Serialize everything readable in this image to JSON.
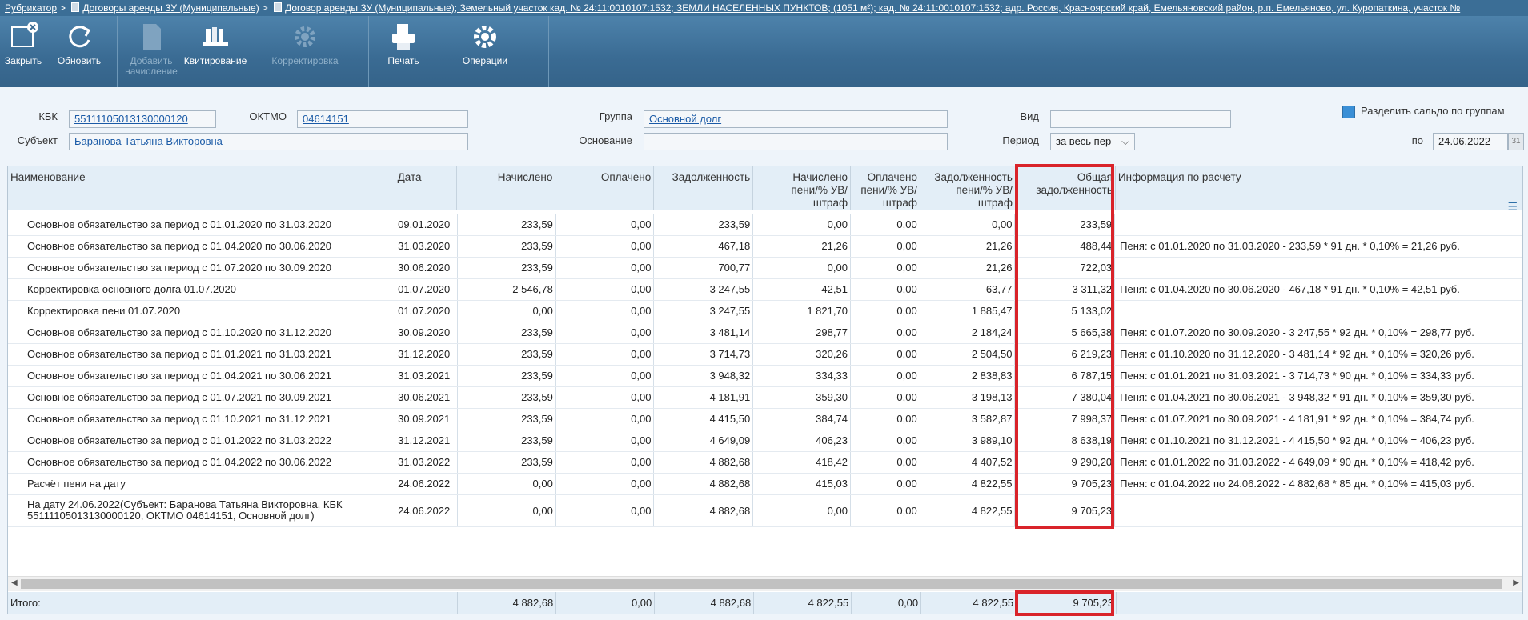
{
  "breadcrumb": {
    "items": [
      "Рубрикатор",
      "Договоры аренды ЗУ (Муниципальные)",
      "Договор аренды ЗУ (Муниципальные); Земельный участок кад. № 24:11:0010107:1532; ЗЕМЛИ НАСЕЛЕННЫХ ПУНКТОВ; (1051 м²); кад. № 24:11:0010107:1532; адр. Россия, Красноярский край, Емельяновский район, р.п. Емельяново, ул. Куропаткина, участок №"
    ],
    "sep": ">"
  },
  "toolbar": {
    "close": "Закрыть",
    "refresh": "Обновить",
    "add_charge": "Добавить начисление",
    "kvit": "Квитирование",
    "correction": "Корректировка",
    "print": "Печать",
    "operations": "Операции"
  },
  "form": {
    "kbk_label": "КБК",
    "kbk_value": "55111105013130000120",
    "oktmo_label": "ОКТМО",
    "oktmo_value": "04614151",
    "subject_label": "Субъект",
    "subject_value": "Баранова Татьяна Викторовна",
    "group_label": "Группа",
    "group_value": "Основной долг",
    "basis_label": "Основание",
    "basis_value": "",
    "vid_label": "Вид",
    "vid_value": "",
    "period_label": "Период",
    "period_value": "за весь пер",
    "split_label": "Разделить сальдо по группам",
    "po_label": "по",
    "date_value": "24.06.2022",
    "calendar_glyph": "31"
  },
  "table": {
    "headers": {
      "name": "Наименование",
      "date": "Дата",
      "charged": "Начислено",
      "paid": "Оплачено",
      "debt": "Задолженность",
      "pen_charged": "Начислено пени/% УВ/ штраф",
      "pen_paid": "Оплачено пени/% УВ/штраф",
      "pen_debt": "Задолженность пени/% УВ/ штраф",
      "total_debt": "Общая задолженность",
      "info": "Информация по расчету"
    },
    "rows": [
      {
        "name": "Основное обязательство за период с 01.01.2020 по 31.03.2020",
        "date": "09.01.2020",
        "charged": "233,59",
        "paid": "0,00",
        "debt": "233,59",
        "pen_charged": "0,00",
        "pen_paid": "0,00",
        "pen_debt": "0,00",
        "total": "233,59",
        "info": ""
      },
      {
        "name": "Основное обязательство за период с 01.04.2020 по 30.06.2020",
        "date": "31.03.2020",
        "charged": "233,59",
        "paid": "0,00",
        "debt": "467,18",
        "pen_charged": "21,26",
        "pen_paid": "0,00",
        "pen_debt": "21,26",
        "total": "488,44",
        "info": "Пеня: с 01.01.2020 по 31.03.2020 - 233,59 *    91 дн. * 0,10%  = 21,26 руб."
      },
      {
        "name": "Основное обязательство за период с 01.07.2020 по 30.09.2020",
        "date": "30.06.2020",
        "charged": "233,59",
        "paid": "0,00",
        "debt": "700,77",
        "pen_charged": "0,00",
        "pen_paid": "0,00",
        "pen_debt": "21,26",
        "total": "722,03",
        "info": ""
      },
      {
        "name": "Корректировка основного долга 01.07.2020",
        "date": "01.07.2020",
        "charged": "2 546,78",
        "paid": "0,00",
        "debt": "3 247,55",
        "pen_charged": "42,51",
        "pen_paid": "0,00",
        "pen_debt": "63,77",
        "total": "3 311,32",
        "info": "Пеня: с 01.04.2020 по 30.06.2020 - 467,18 *    91 дн. * 0,10%  = 42,51 руб."
      },
      {
        "name": "Корректировка пени 01.07.2020",
        "date": "01.07.2020",
        "charged": "0,00",
        "paid": "0,00",
        "debt": "3 247,55",
        "pen_charged": "1 821,70",
        "pen_paid": "0,00",
        "pen_debt": "1 885,47",
        "total": "5 133,02",
        "info": ""
      },
      {
        "name": "Основное обязательство за период с 01.10.2020 по 31.12.2020",
        "date": "30.09.2020",
        "charged": "233,59",
        "paid": "0,00",
        "debt": "3 481,14",
        "pen_charged": "298,77",
        "pen_paid": "0,00",
        "pen_debt": "2 184,24",
        "total": "5 665,38",
        "info": "Пеня: с 01.07.2020 по 30.09.2020 - 3 247,55 *    92 дн. * 0,10%  = 298,77 руб."
      },
      {
        "name": "Основное обязательство за период с 01.01.2021 по 31.03.2021",
        "date": "31.12.2020",
        "charged": "233,59",
        "paid": "0,00",
        "debt": "3 714,73",
        "pen_charged": "320,26",
        "pen_paid": "0,00",
        "pen_debt": "2 504,50",
        "total": "6 219,23",
        "info": "Пеня: с 01.10.2020 по 31.12.2020 - 3 481,14 *    92 дн. * 0,10%  = 320,26 руб."
      },
      {
        "name": "Основное обязательство за период с 01.04.2021 по 30.06.2021",
        "date": "31.03.2021",
        "charged": "233,59",
        "paid": "0,00",
        "debt": "3 948,32",
        "pen_charged": "334,33",
        "pen_paid": "0,00",
        "pen_debt": "2 838,83",
        "total": "6 787,15",
        "info": "Пеня: с 01.01.2021 по 31.03.2021 - 3 714,73 *    90 дн. * 0,10%  = 334,33 руб."
      },
      {
        "name": "Основное обязательство за период с 01.07.2021 по 30.09.2021",
        "date": "30.06.2021",
        "charged": "233,59",
        "paid": "0,00",
        "debt": "4 181,91",
        "pen_charged": "359,30",
        "pen_paid": "0,00",
        "pen_debt": "3 198,13",
        "total": "7 380,04",
        "info": "Пеня: с 01.04.2021 по 30.06.2021 - 3 948,32 *    91 дн. * 0,10%  = 359,30 руб."
      },
      {
        "name": "Основное обязательство за период с 01.10.2021 по 31.12.2021",
        "date": "30.09.2021",
        "charged": "233,59",
        "paid": "0,00",
        "debt": "4 415,50",
        "pen_charged": "384,74",
        "pen_paid": "0,00",
        "pen_debt": "3 582,87",
        "total": "7 998,37",
        "info": "Пеня: с 01.07.2021 по 30.09.2021 - 4 181,91 *    92 дн. * 0,10%  = 384,74 руб."
      },
      {
        "name": "Основное обязательство за период с 01.01.2022 по 31.03.2022",
        "date": "31.12.2021",
        "charged": "233,59",
        "paid": "0,00",
        "debt": "4 649,09",
        "pen_charged": "406,23",
        "pen_paid": "0,00",
        "pen_debt": "3 989,10",
        "total": "8 638,19",
        "info": "Пеня: с 01.10.2021 по 31.12.2021 - 4 415,50 *    92 дн. * 0,10%  = 406,23 руб."
      },
      {
        "name": "Основное обязательство за период с 01.04.2022 по 30.06.2022",
        "date": "31.03.2022",
        "charged": "233,59",
        "paid": "0,00",
        "debt": "4 882,68",
        "pen_charged": "418,42",
        "pen_paid": "0,00",
        "pen_debt": "4 407,52",
        "total": "9 290,20",
        "info": "Пеня: с 01.01.2022 по 31.03.2022 - 4 649,09 *    90 дн. * 0,10%  = 418,42 руб."
      },
      {
        "name": "Расчёт пени на дату",
        "date": "24.06.2022",
        "charged": "0,00",
        "paid": "0,00",
        "debt": "4 882,68",
        "pen_charged": "415,03",
        "pen_paid": "0,00",
        "pen_debt": "4 822,55",
        "total": "9 705,23",
        "info": "Пеня: с 01.04.2022 по 24.06.2022 - 4 882,68 *    85 дн. * 0,10%  = 415,03 руб."
      },
      {
        "name": "На дату 24.06.2022(Субъект: Баранова Татьяна Викторовна, КБК 55111105013130000120, ОКТМО 04614151, Основной долг)",
        "date": "24.06.2022",
        "charged": "0,00",
        "paid": "0,00",
        "debt": "4 882,68",
        "pen_charged": "0,00",
        "pen_paid": "0,00",
        "pen_debt": "4 822,55",
        "total": "9 705,23",
        "info": ""
      }
    ],
    "footer": {
      "label": "Итого:",
      "charged": "4 882,68",
      "paid": "0,00",
      "debt": "4 882,68",
      "pen_charged": "4 822,55",
      "pen_paid": "0,00",
      "pen_debt": "4 822,55",
      "total": "9 705,23"
    }
  },
  "colors": {
    "highlight": "#d9232a",
    "toolbar": "#3a6b93"
  }
}
